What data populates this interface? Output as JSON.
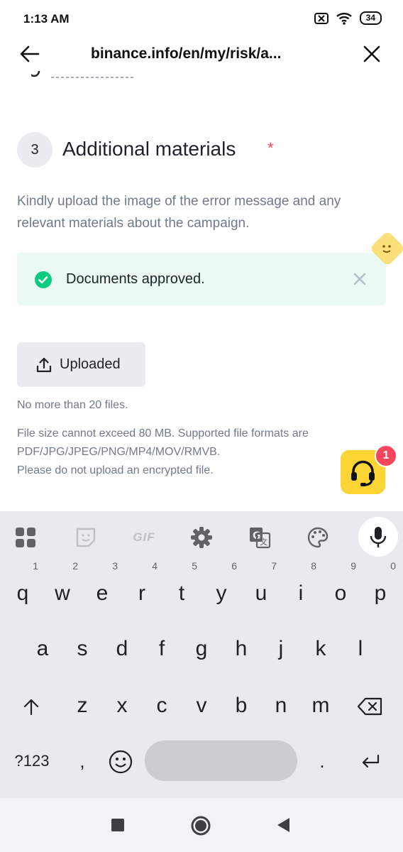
{
  "status": {
    "time": "1:13 AM",
    "battery": "34"
  },
  "browser": {
    "title": "binance.info/en/my/risk/a..."
  },
  "section": {
    "step": "3",
    "title": "Additional materials",
    "required_mark": "*",
    "description": "Kindly upload the image of the error message and any relevant materials about the campaign."
  },
  "notice": {
    "text": "Documents approved."
  },
  "upload": {
    "button_label": "Uploaded",
    "hint_count": "No more than 20 files.",
    "hint_size": "File size cannot exceed 80 MB. Supported file formats are PDF/JPG/JPEG/PNG/MP4/MOV/RMVB.",
    "hint_encrypt": "Please do not upload an encrypted file."
  },
  "support": {
    "badge_count": "1"
  },
  "keyboard": {
    "toolbar": {
      "gif_label": "GIF"
    },
    "row1": [
      "q",
      "w",
      "e",
      "r",
      "t",
      "y",
      "u",
      "i",
      "o",
      "p"
    ],
    "row1_numbers": [
      "1",
      "2",
      "3",
      "4",
      "5",
      "6",
      "7",
      "8",
      "9",
      "0"
    ],
    "row2": [
      "a",
      "s",
      "d",
      "f",
      "g",
      "h",
      "j",
      "k",
      "l"
    ],
    "row3": [
      "z",
      "x",
      "c",
      "v",
      "b",
      "n",
      "m"
    ],
    "symbols_label": "?123",
    "comma": ",",
    "period": "."
  },
  "colors": {
    "accent": "#FCD535",
    "success": "#0ECB81",
    "danger": "#F6465D",
    "muted": "#707A8A"
  }
}
